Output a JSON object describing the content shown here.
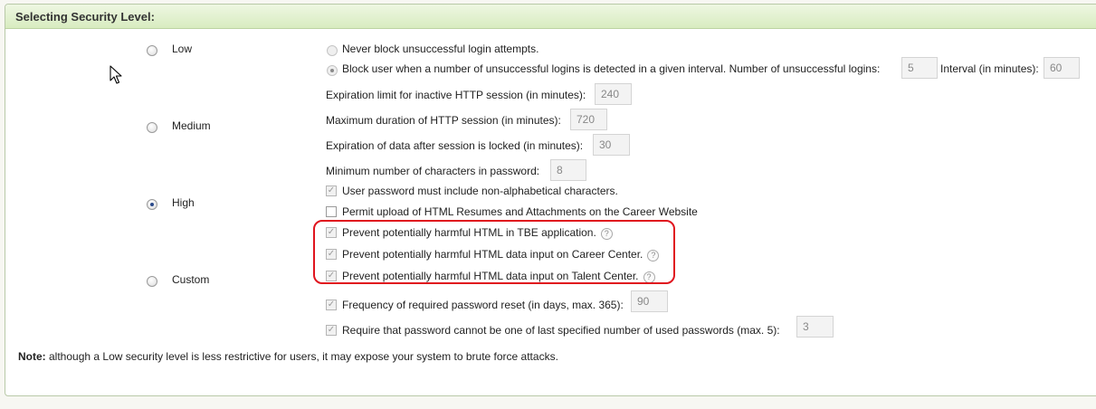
{
  "section": {
    "title": "Selecting Security Level:"
  },
  "levels": {
    "low": "Low",
    "medium": "Medium",
    "high": "High",
    "custom": "Custom",
    "selected": "High"
  },
  "login": {
    "never_block": "Never block unsuccessful login attempts.",
    "block_user": "Block user when a number of unsuccessful logins is detected in a given interval. Number of unsuccessful logins:",
    "unsuccessful_logins": "5",
    "interval_label": "Interval (in minutes):",
    "interval": "60"
  },
  "session": {
    "inactive_label": "Expiration limit for inactive HTTP session (in minutes):",
    "inactive": "240",
    "max_duration_label": "Maximum duration of HTTP session (in minutes):",
    "max_duration": "720",
    "locked_label": "Expiration of data after session is locked (in minutes):",
    "locked": "30"
  },
  "password": {
    "min_chars_label": "Minimum number of characters in password:",
    "min_chars": "8",
    "non_alpha": "User password must include non-alphabetical characters."
  },
  "options": {
    "permit_upload": "Permit upload of HTML Resumes and Attachments on the Career Website",
    "prevent_tbe": "Prevent potentially harmful HTML in TBE application.",
    "prevent_career": "Prevent potentially harmful HTML data input on Career Center.",
    "prevent_talent": "Prevent potentially harmful HTML data input on Talent Center.",
    "help_glyph": "?"
  },
  "reset": {
    "frequency_label": "Frequency of required password reset (in days, max. 365):",
    "frequency": "90",
    "history_label": "Require that password cannot be one of last specified number of used passwords (max. 5):",
    "history": "3"
  },
  "note": {
    "prefix": "Note:",
    "text": " although a Low security level is less restrictive for users, it may expose your system to brute force attacks."
  },
  "colors": {
    "header_green": "#d8ecc0",
    "highlight_red": "#e0141e",
    "radio_selected": "#2b4a8b"
  },
  "icons": {
    "cursor": "mouse-pointer-icon",
    "help": "help-circle-icon",
    "checkmark": "checkmark-icon"
  }
}
